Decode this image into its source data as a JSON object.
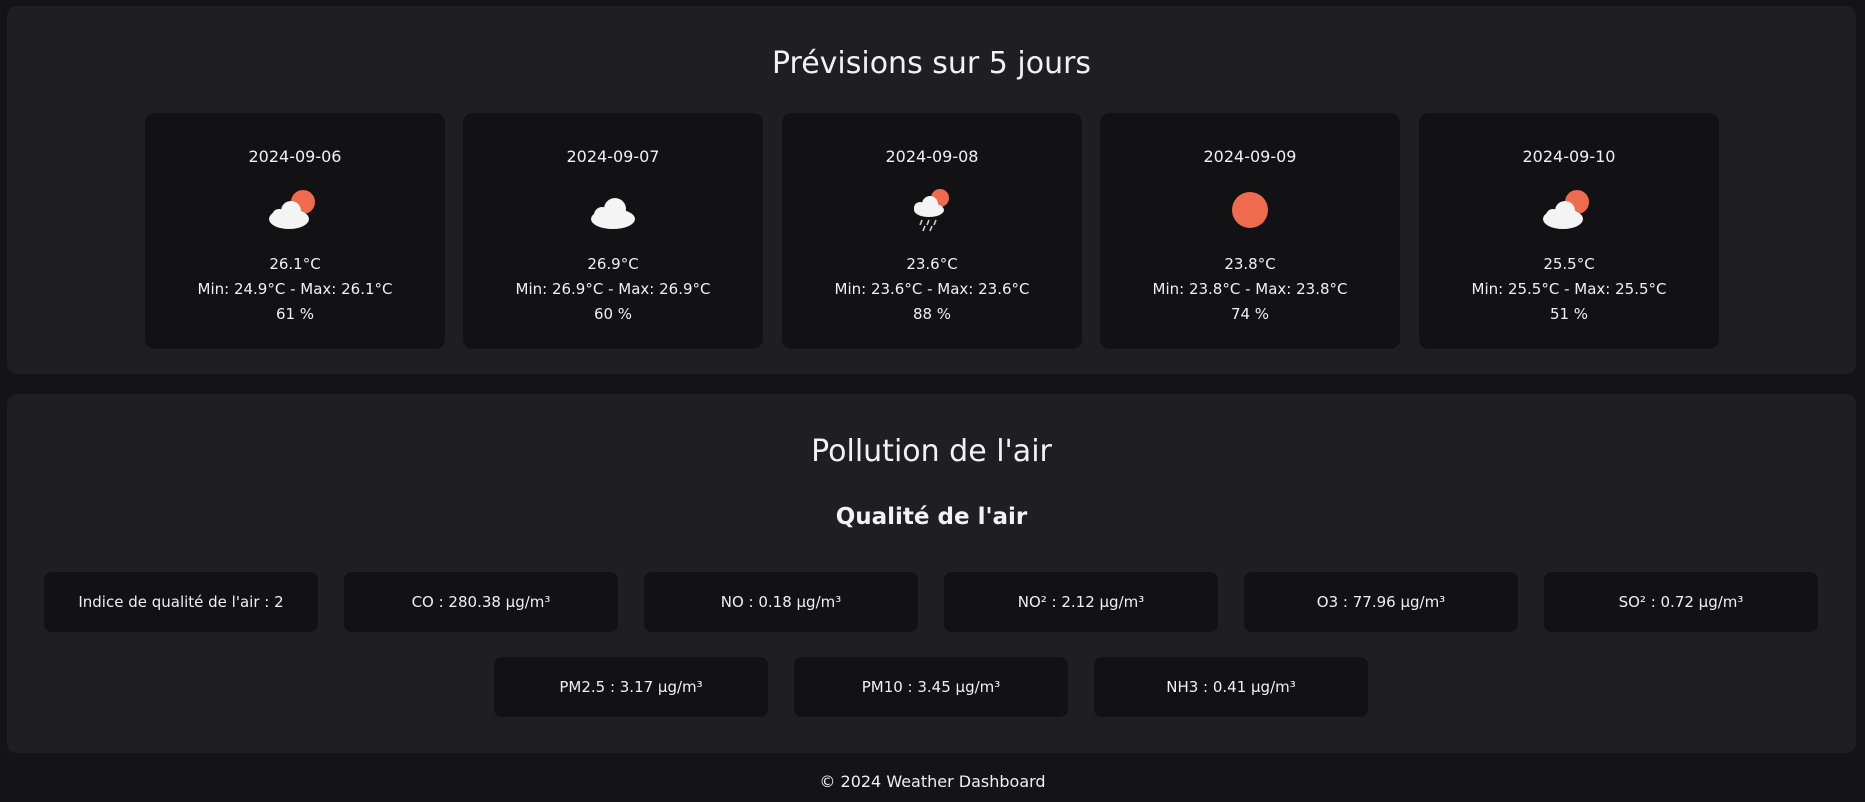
{
  "forecast": {
    "title": "Prévisions sur 5 jours",
    "days": [
      {
        "date": "2024-09-06",
        "icon": "partly-cloudy-icon",
        "temp": "26.1°C",
        "range": "Min: 24.9°C - Max: 26.1°C",
        "humidity": "61 %"
      },
      {
        "date": "2024-09-07",
        "icon": "cloud-icon",
        "temp": "26.9°C",
        "range": "Min: 26.9°C - Max: 26.9°C",
        "humidity": "60 %"
      },
      {
        "date": "2024-09-08",
        "icon": "rain-sun-icon",
        "temp": "23.6°C",
        "range": "Min: 23.6°C - Max: 23.6°C",
        "humidity": "88 %"
      },
      {
        "date": "2024-09-09",
        "icon": "sun-icon",
        "temp": "23.8°C",
        "range": "Min: 23.8°C - Max: 23.8°C",
        "humidity": "74 %"
      },
      {
        "date": "2024-09-10",
        "icon": "partly-cloudy-icon",
        "temp": "25.5°C",
        "range": "Min: 25.5°C - Max: 25.5°C",
        "humidity": "51 %"
      }
    ]
  },
  "pollution": {
    "title": "Pollution de l'air",
    "subtitle": "Qualité de l'air",
    "items": [
      "Indice de qualité de l'air : 2",
      "CO : 280.38 µg/m³",
      "NO : 0.18 µg/m³",
      "NO² : 2.12 µg/m³",
      "O3 : 77.96 µg/m³",
      "SO² : 0.72 µg/m³",
      "PM2.5 : 3.17 µg/m³",
      "PM10 : 3.45 µg/m³",
      "NH3 : 0.41 µg/m³"
    ]
  },
  "footer": {
    "text": "© 2024 Weather Dashboard"
  },
  "colors": {
    "background": "#141416",
    "panel": "#1f1f21",
    "card": "#121214",
    "sun": "#ee6b4d",
    "cloud": "#f4f4f4"
  }
}
